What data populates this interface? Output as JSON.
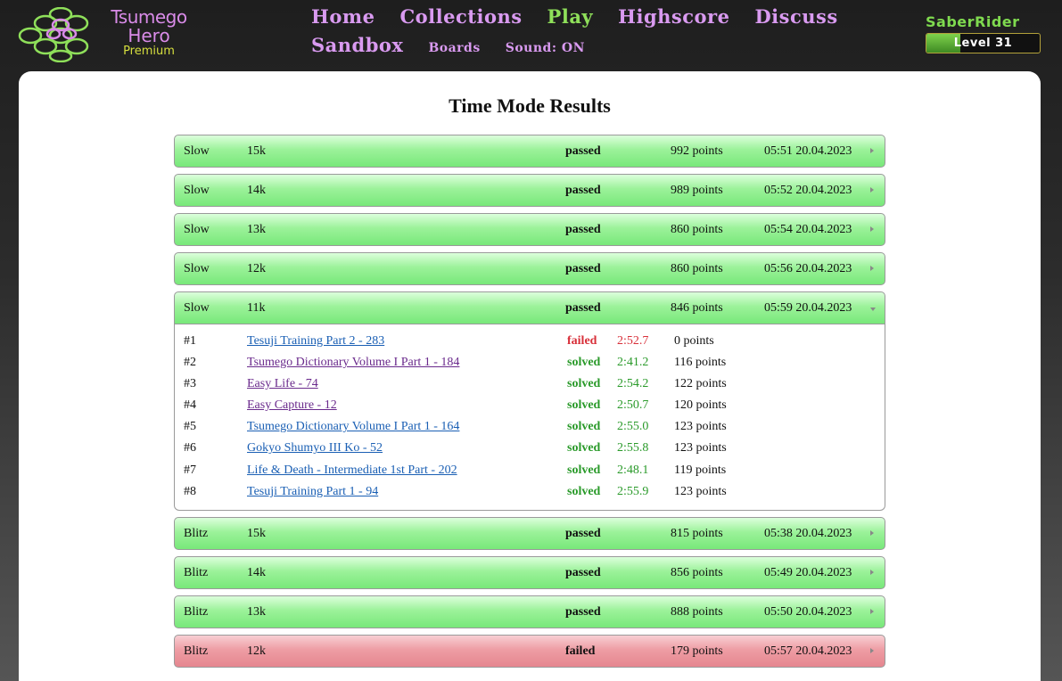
{
  "logo": {
    "line1": "Tsumego",
    "line2": "Hero",
    "line3": "Premium"
  },
  "nav": {
    "row1": [
      {
        "label": "Home",
        "active": false
      },
      {
        "label": "Collections",
        "active": false
      },
      {
        "label": "Play",
        "active": true
      },
      {
        "label": "Highscore",
        "active": false
      },
      {
        "label": "Discuss",
        "active": false
      }
    ],
    "sandbox": "Sandbox",
    "boards": "Boards",
    "sound": "Sound: ON"
  },
  "user": {
    "name": "SaberRider",
    "level_label": "Level 31",
    "level_progress": 0.3
  },
  "page": {
    "title": "Time Mode Results"
  },
  "results": [
    {
      "mode": "Slow",
      "rank": "15k",
      "status": "passed",
      "points": "992 points",
      "date": "05:51 20.04.2023"
    },
    {
      "mode": "Slow",
      "rank": "14k",
      "status": "passed",
      "points": "989 points",
      "date": "05:52 20.04.2023"
    },
    {
      "mode": "Slow",
      "rank": "13k",
      "status": "passed",
      "points": "860 points",
      "date": "05:54 20.04.2023"
    },
    {
      "mode": "Slow",
      "rank": "12k",
      "status": "passed",
      "points": "860 points",
      "date": "05:56 20.04.2023"
    },
    {
      "mode": "Slow",
      "rank": "11k",
      "status": "passed",
      "points": "846 points",
      "date": "05:59 20.04.2023",
      "expanded": true,
      "problems": [
        {
          "num": "#1",
          "name": "Tesuji Training Part 2 - 283",
          "visited": false,
          "status": "failed",
          "time": "2:52.7",
          "points": "0 points"
        },
        {
          "num": "#2",
          "name": "Tsumego Dictionary Volume I Part 1 - 184",
          "visited": true,
          "status": "solved",
          "time": "2:41.2",
          "points": "116 points"
        },
        {
          "num": "#3",
          "name": "Easy Life - 74",
          "visited": true,
          "status": "solved",
          "time": "2:54.2",
          "points": "122 points"
        },
        {
          "num": "#4",
          "name": "Easy Capture - 12",
          "visited": true,
          "status": "solved",
          "time": "2:50.7",
          "points": "120 points"
        },
        {
          "num": "#5",
          "name": "Tsumego Dictionary Volume I Part 1 - 164",
          "visited": false,
          "status": "solved",
          "time": "2:55.0",
          "points": "123 points"
        },
        {
          "num": "#6",
          "name": "Gokyo Shumyo III Ko - 52",
          "visited": false,
          "status": "solved",
          "time": "2:55.8",
          "points": "123 points"
        },
        {
          "num": "#7",
          "name": "Life & Death - Intermediate 1st Part - 202",
          "visited": false,
          "status": "solved",
          "time": "2:48.1",
          "points": "119 points"
        },
        {
          "num": "#8",
          "name": "Tesuji Training Part 1 - 94",
          "visited": false,
          "status": "solved",
          "time": "2:55.9",
          "points": "123 points"
        }
      ]
    },
    {
      "mode": "Blitz",
      "rank": "15k",
      "status": "passed",
      "points": "815 points",
      "date": "05:38 20.04.2023"
    },
    {
      "mode": "Blitz",
      "rank": "14k",
      "status": "passed",
      "points": "856 points",
      "date": "05:49 20.04.2023"
    },
    {
      "mode": "Blitz",
      "rank": "13k",
      "status": "passed",
      "points": "888 points",
      "date": "05:50 20.04.2023"
    },
    {
      "mode": "Blitz",
      "rank": "12k",
      "status": "failed",
      "points": "179 points",
      "date": "05:57 20.04.2023"
    }
  ]
}
